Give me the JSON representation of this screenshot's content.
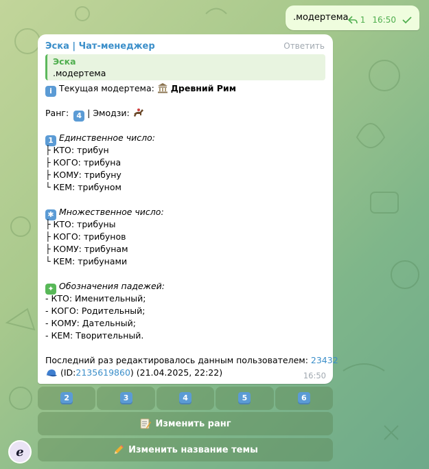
{
  "outgoing": {
    "text": ".модертема",
    "reply_count": "1",
    "time": "16:50"
  },
  "incoming": {
    "sender": "Эска | Чат-менеджер",
    "reply_label": "Ответить",
    "quote": {
      "name": "Эска",
      "text": ".модертема"
    },
    "current_label": "Текущая модертема:",
    "current_value": "Древний Рим",
    "rank_label": "Ранг:",
    "rank_value": "4",
    "emoji_label": "| Эмодзи:",
    "singular_title": "Единственное число:",
    "singular": [
      "├ КТО: трибун",
      "├ КОГО: трибуна",
      "├ КОМУ: трибуну",
      "└ КЕМ: трибуном"
    ],
    "plural_title": "Множественное число:",
    "plural": [
      "├ КТО: трибуны",
      "├ КОГО: трибунов",
      "├ КОМУ: трибунам",
      "└ КЕМ: трибунами"
    ],
    "cases_title": "Обозначения падежей:",
    "cases": [
      "- КТО: Именительный;",
      "- КОГО: Родительный;",
      "- КОМУ: Дательный;",
      "- КЕМ: Творительный."
    ],
    "edited_prefix": "Последний раз редактировалось данным пользователем:",
    "edited_user": "23432",
    "id_prefix": "(ID:",
    "id_value": "2135619860",
    "id_suffix": ") (21.04.2025, 22:22)",
    "time": "16:50"
  },
  "keyboard": {
    "rank_buttons": [
      "2",
      "3",
      "4",
      "5",
      "6"
    ],
    "change_rank": "Изменить ранг",
    "change_name": "Изменить название темы"
  },
  "icons": {
    "info": "info-icon",
    "museum": "classical-building-icon",
    "horse": "horse-racing-icon",
    "cap": "blue-cap-icon",
    "memo": "memo-icon",
    "pencil": "pencil-icon"
  },
  "colors": {
    "accent": "#3a8ec9",
    "out_bg": "#effdde",
    "green": "#4fae4e"
  }
}
